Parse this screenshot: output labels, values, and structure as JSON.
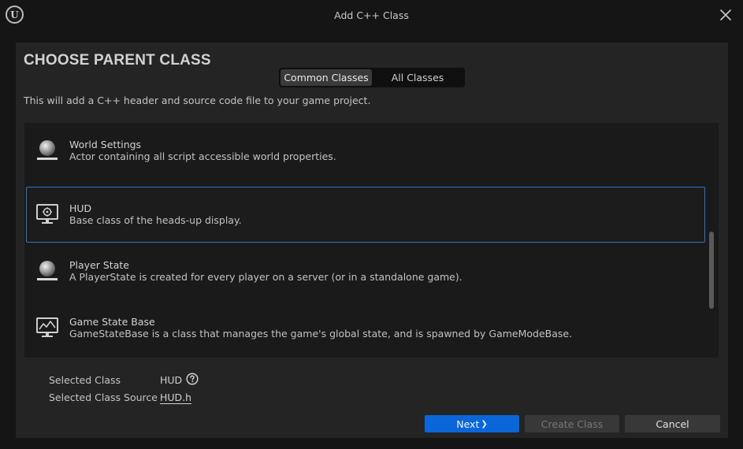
{
  "window": {
    "title": "Add C++ Class",
    "logo_text": "U"
  },
  "header": {
    "heading": "CHOOSE PARENT CLASS",
    "description": "This will add a C++ header and source code file to your game project."
  },
  "tabs": [
    {
      "label": "Common Classes",
      "active": true
    },
    {
      "label": "All Classes",
      "active": false
    }
  ],
  "classes": [
    {
      "name": "World Settings",
      "description": "Actor containing all script accessible world properties.",
      "icon": "sphere-actor-icon",
      "selected": false
    },
    {
      "name": "HUD",
      "description": "Base class of the heads-up display.",
      "icon": "hud-monitor-icon",
      "selected": true
    },
    {
      "name": "Player State",
      "description": "A PlayerState is created for every player on a server (or in a standalone game).",
      "icon": "sphere-actor-icon",
      "selected": false
    },
    {
      "name": "Game State Base",
      "description": "GameStateBase is a class that manages the game's global state, and is spawned by GameModeBase.",
      "icon": "graph-monitor-icon",
      "selected": false
    }
  ],
  "selection": {
    "class_label": "Selected Class",
    "class_value": "HUD",
    "source_label": "Selected Class Source",
    "source_value": "HUD.h"
  },
  "buttons": {
    "next": "Next",
    "create": "Create Class",
    "cancel": "Cancel"
  },
  "colors": {
    "accent": "#0a66d9",
    "selection_border": "#2f73c9",
    "panel": "#242424",
    "background": "#151515"
  }
}
